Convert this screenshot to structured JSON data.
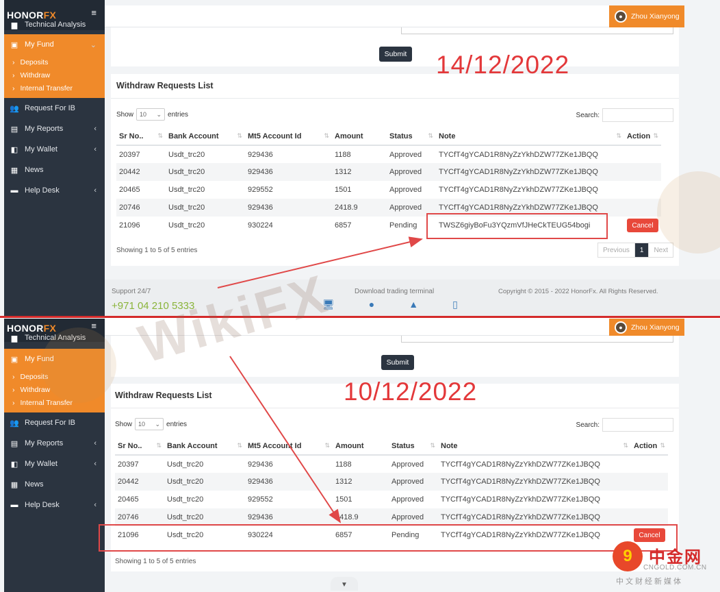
{
  "brand": {
    "name_prefix": "HONOR",
    "name_suffix": "FX",
    "menu_icon": "hamburger-icon"
  },
  "user": {
    "name": "Zhou Xianyong"
  },
  "sidebar": {
    "partial_item": "Technical Analysis",
    "items": [
      {
        "label": "My Fund",
        "icon": "fund-icon"
      },
      {
        "label": "Request For IB",
        "icon": "users-icon"
      },
      {
        "label": "My Reports",
        "icon": "reports-icon"
      },
      {
        "label": "My Wallet",
        "icon": "wallet-icon"
      },
      {
        "label": "News",
        "icon": "news-icon"
      },
      {
        "label": "Help Desk",
        "icon": "help-icon"
      }
    ],
    "submenu": [
      "Deposits",
      "Withdraw",
      "Internal Transfer"
    ],
    "submenu_b": [
      "Deposits",
      "Withdraw",
      "Internal Transfer"
    ]
  },
  "form": {
    "submit_label": "Submit"
  },
  "card": {
    "title": "Withdraw Requests List",
    "show_label": "Show",
    "entries_label": "entries",
    "page_size": "10",
    "search_label": "Search:",
    "info": "Showing 1 to 5 of 5 entries",
    "prev": "Previous",
    "page": "1",
    "next": "Next"
  },
  "table": {
    "headers": [
      "Sr No..",
      "Bank Account",
      "Mt5 Account Id",
      "Amount",
      "Status",
      "Note",
      "Action"
    ],
    "rows_top": [
      [
        "20397",
        "Usdt_trc20",
        "929436",
        "1188",
        "Approved",
        "TYCfT4gYCAD1R8NyZzYkhDZW77ZKe1JBQQ",
        ""
      ],
      [
        "20442",
        "Usdt_trc20",
        "929436",
        "1312",
        "Approved",
        "TYCfT4gYCAD1R8NyZzYkhDZW77ZKe1JBQQ",
        ""
      ],
      [
        "20465",
        "Usdt_trc20",
        "929552",
        "1501",
        "Approved",
        "TYCfT4gYCAD1R8NyZzYkhDZW77ZKe1JBQQ",
        ""
      ],
      [
        "20746",
        "Usdt_trc20",
        "929436",
        "2418.9",
        "Approved",
        "TYCfT4gYCAD1R8NyZzYkhDZW77ZKe1JBQQ",
        ""
      ],
      [
        "21096",
        "Usdt_trc20",
        "930224",
        "6857",
        "Pending",
        "TWSZ6giyBoFu3YQzmVfJHeCkTEUG54bogi",
        "Cancel"
      ]
    ],
    "rows_bottom": [
      [
        "20397",
        "Usdt_trc20",
        "929436",
        "1188",
        "Approved",
        "TYCfT4gYCAD1R8NyZzYkhDZW77ZKe1JBQQ",
        ""
      ],
      [
        "20442",
        "Usdt_trc20",
        "929436",
        "1312",
        "Approved",
        "TYCfT4gYCAD1R8NyZzYkhDZW77ZKe1JBQQ",
        ""
      ],
      [
        "20465",
        "Usdt_trc20",
        "929552",
        "1501",
        "Approved",
        "TYCfT4gYCAD1R8NyZzYkhDZW77ZKe1JBQQ",
        ""
      ],
      [
        "20746",
        "Usdt_trc20",
        "929436",
        "2418.9",
        "Approved",
        "TYCfT4gYCAD1R8NyZzYkhDZW77ZKe1JBQQ",
        ""
      ],
      [
        "21096",
        "Usdt_trc20",
        "930224",
        "6857",
        "Pending",
        "TYCfT4gYCAD1R8NyZzYkhDZW77ZKe1JBQQ",
        "Cancel"
      ]
    ]
  },
  "footer": {
    "support": "Support 24/7",
    "phone": "+971 04 210 5333",
    "download": "Download trading terminal",
    "copyright": "Copyright © 2015 - 2022 HonorFx. All Rights Reserved."
  },
  "annotations": {
    "date_top": "14/12/2022",
    "date_bottom": "10/12/2022",
    "color": "#e3383a"
  },
  "watermark": {
    "text": "WikiFX"
  },
  "badge": {
    "glyph": "9",
    "name": "中金网",
    "domain": "CNGOLD.COM.CN",
    "sub": "中文财经新媒体"
  },
  "colors": {
    "accent": "#f08a2a",
    "sidebar": "#2b3440",
    "cancel": "#e8483a"
  }
}
